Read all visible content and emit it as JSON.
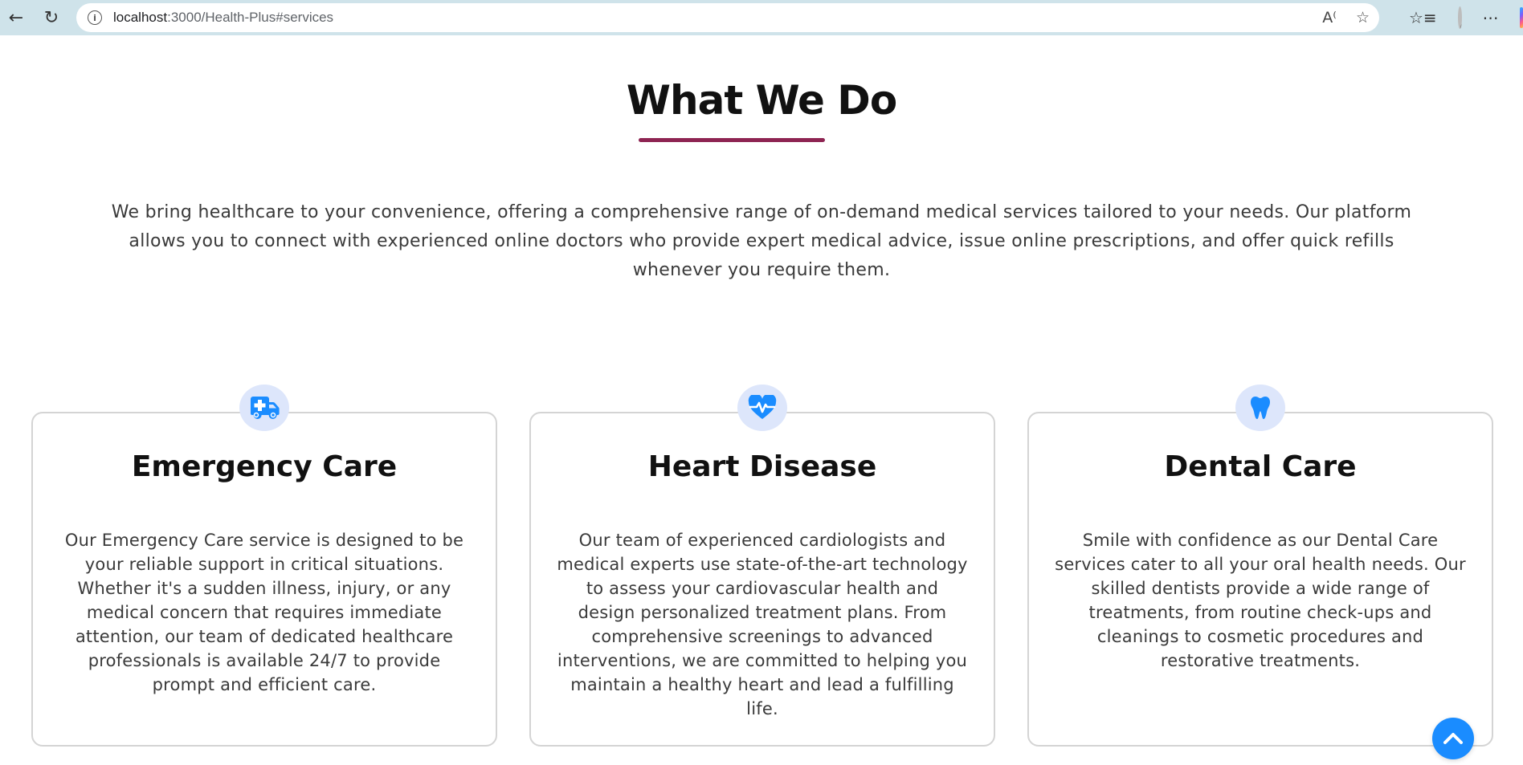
{
  "browser": {
    "url_host": "localhost",
    "url_path": ":3000/Health-Plus#services"
  },
  "section": {
    "title": "What We Do",
    "intro": "We bring healthcare to your convenience, offering a comprehensive range of on-demand medical services tailored to your needs. Our platform allows you to connect with experienced online doctors who provide expert medical advice, issue online prescriptions, and offer quick refills whenever you require them."
  },
  "cards": [
    {
      "icon": "truck-medical-icon",
      "title": "Emergency Care",
      "text": "Our Emergency Care service is designed to be your reliable support in critical situations. Whether it's a sudden illness, injury, or any medical concern that requires immediate attention, our team of dedicated healthcare professionals is available 24/7 to provide prompt and efficient care."
    },
    {
      "icon": "heart-pulse-icon",
      "title": "Heart Disease",
      "text": "Our team of experienced cardiologists and medical experts use state-of-the-art technology to assess your cardiovascular health and design personalized treatment plans. From comprehensive screenings to advanced interventions, we are committed to helping you maintain a healthy heart and lead a fulfilling life."
    },
    {
      "icon": "tooth-icon",
      "title": "Dental Care",
      "text": "Smile with confidence as our Dental Care services cater to all your oral health needs. Our skilled dentists provide a wide range of treatments, from routine check-ups and cleanings to cosmetic procedures and restorative treatments."
    }
  ],
  "colors": {
    "accent_underline": "#8e2452",
    "icon_blue": "#1a8cff",
    "icon_bg": "#dde6fb"
  }
}
